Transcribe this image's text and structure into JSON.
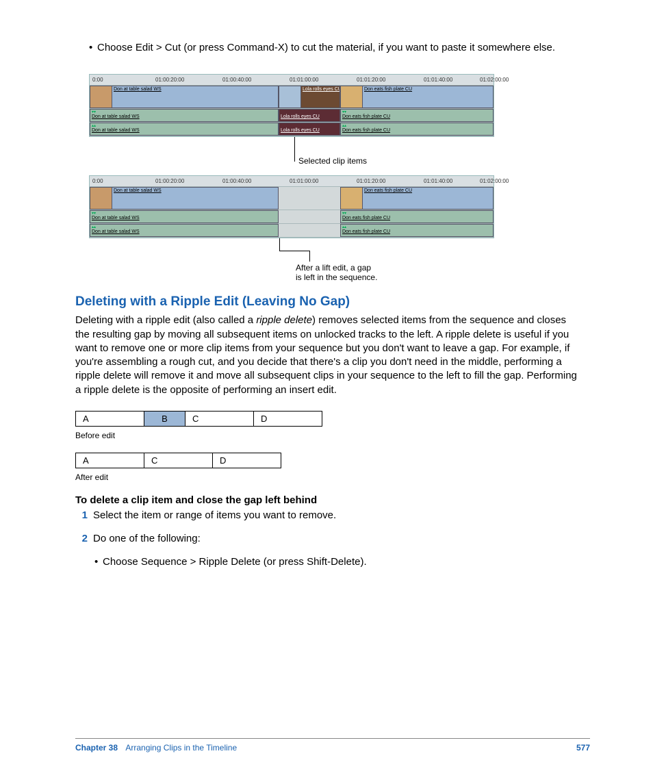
{
  "bullet1": "Choose Edit > Cut (or press Command-X) to cut the material, if you want to paste it somewhere else.",
  "ruler": {
    "t0": "0:00",
    "t1": "01:00:20:00",
    "t2": "01:00:40:00",
    "t3": "01:01:00:00",
    "t4": "01:01:20:00",
    "t5": "01:01:40:00",
    "t6": "01:02:00:00"
  },
  "clips": {
    "a": "Don at table salad WS",
    "b": "Lola rolls eyes CU",
    "c": "Don eats fish plate CU"
  },
  "callout1": "Selected clip items",
  "callout2a": "After a lift edit, a gap",
  "callout2b": "is left in the sequence.",
  "heading": "Deleting with a Ripple Edit (Leaving No Gap)",
  "para_pre": "Deleting with a ripple edit (also called a ",
  "para_em": "ripple delete",
  "para_post": ") removes selected items from the sequence and closes the resulting gap by moving all subsequent items on unlocked tracks to the left. A ripple delete is useful if you want to remove one or more clip items from your sequence but you don't want to leave a gap. For example, if you're assembling a rough cut, and you decide that there's a clip you don't need in the middle, performing a ripple delete will remove it and move all subsequent clips in your sequence to the left to fill the gap. Performing a ripple delete is the opposite of performing an insert edit.",
  "diag1": {
    "a": "A",
    "b": "B",
    "c": "C",
    "d": "D"
  },
  "diag_cap1": "Before edit",
  "diag2": {
    "a": "A",
    "c": "C",
    "d": "D"
  },
  "diag_cap2": "After edit",
  "subhead": "To delete a clip item and close the gap left behind",
  "step1": "Select the item or range of items you want to remove.",
  "step2": "Do one of the following:",
  "bullet2": "Choose Sequence > Ripple Delete (or press Shift-Delete).",
  "footer": {
    "chapter_label": "Chapter 38",
    "chapter_title": "Arranging Clips in the Timeline",
    "page": "577"
  }
}
